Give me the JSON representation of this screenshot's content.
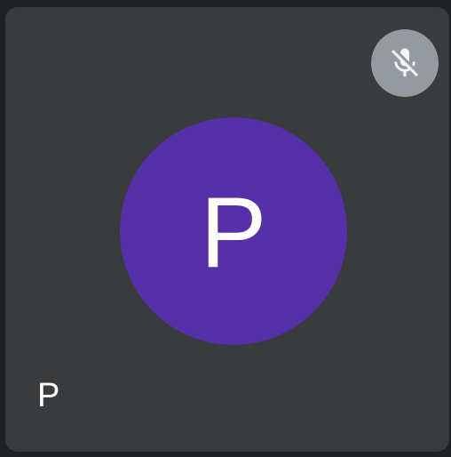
{
  "participant": {
    "avatar_letter": "P",
    "name": "P",
    "avatar_color": "#5630a8",
    "tile_background": "#3a3b3d",
    "mic_status": "muted",
    "mic_icon": "mic-off-icon"
  }
}
